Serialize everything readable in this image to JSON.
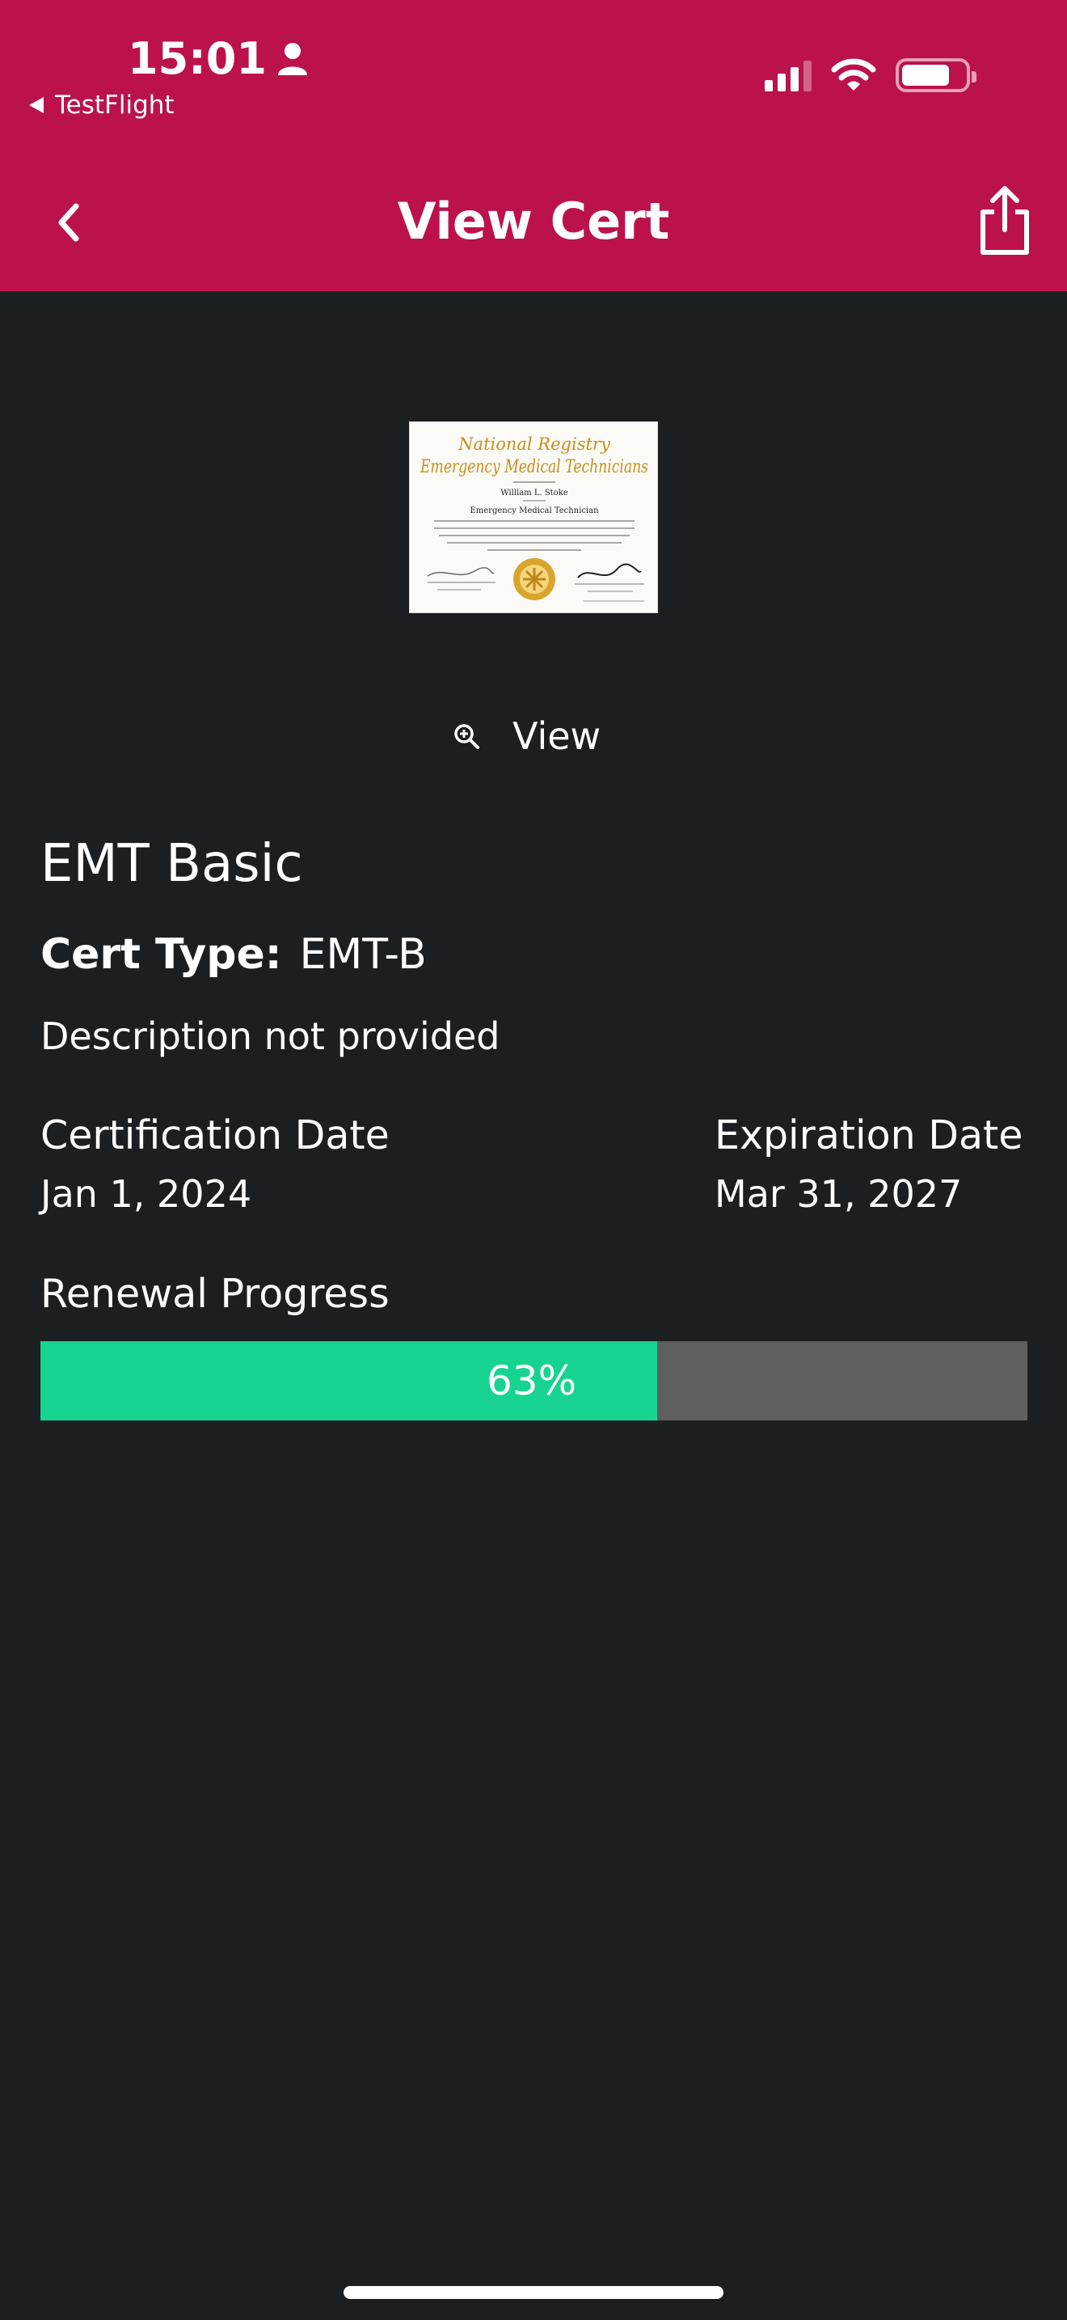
{
  "status_bar": {
    "time": "15:01",
    "back_app": "TestFlight"
  },
  "nav": {
    "title": "View Cert"
  },
  "certificate_image": {
    "line1": "National Registry",
    "line2": "Emergency Medical Technicians",
    "name": "William L. Stoke",
    "role": "Emergency Medical Technician"
  },
  "view_button": {
    "label": "View"
  },
  "cert": {
    "name": "EMT Basic",
    "type_label": "Cert Type:",
    "type_value": "EMT-B",
    "description": "Description not provided",
    "certification_date_label": "Certification Date",
    "certification_date": "Jan 1, 2024",
    "expiration_date_label": "Expiration Date",
    "expiration_date": "Mar 31, 2027"
  },
  "renewal": {
    "label": "Renewal Progress",
    "percent_text": "63%",
    "progress_fraction": 0.625
  },
  "colors": {
    "header": "#bb124b",
    "background": "#1c1f22",
    "progress_fill": "#16d48f",
    "progress_track": "#5f5f5f"
  }
}
